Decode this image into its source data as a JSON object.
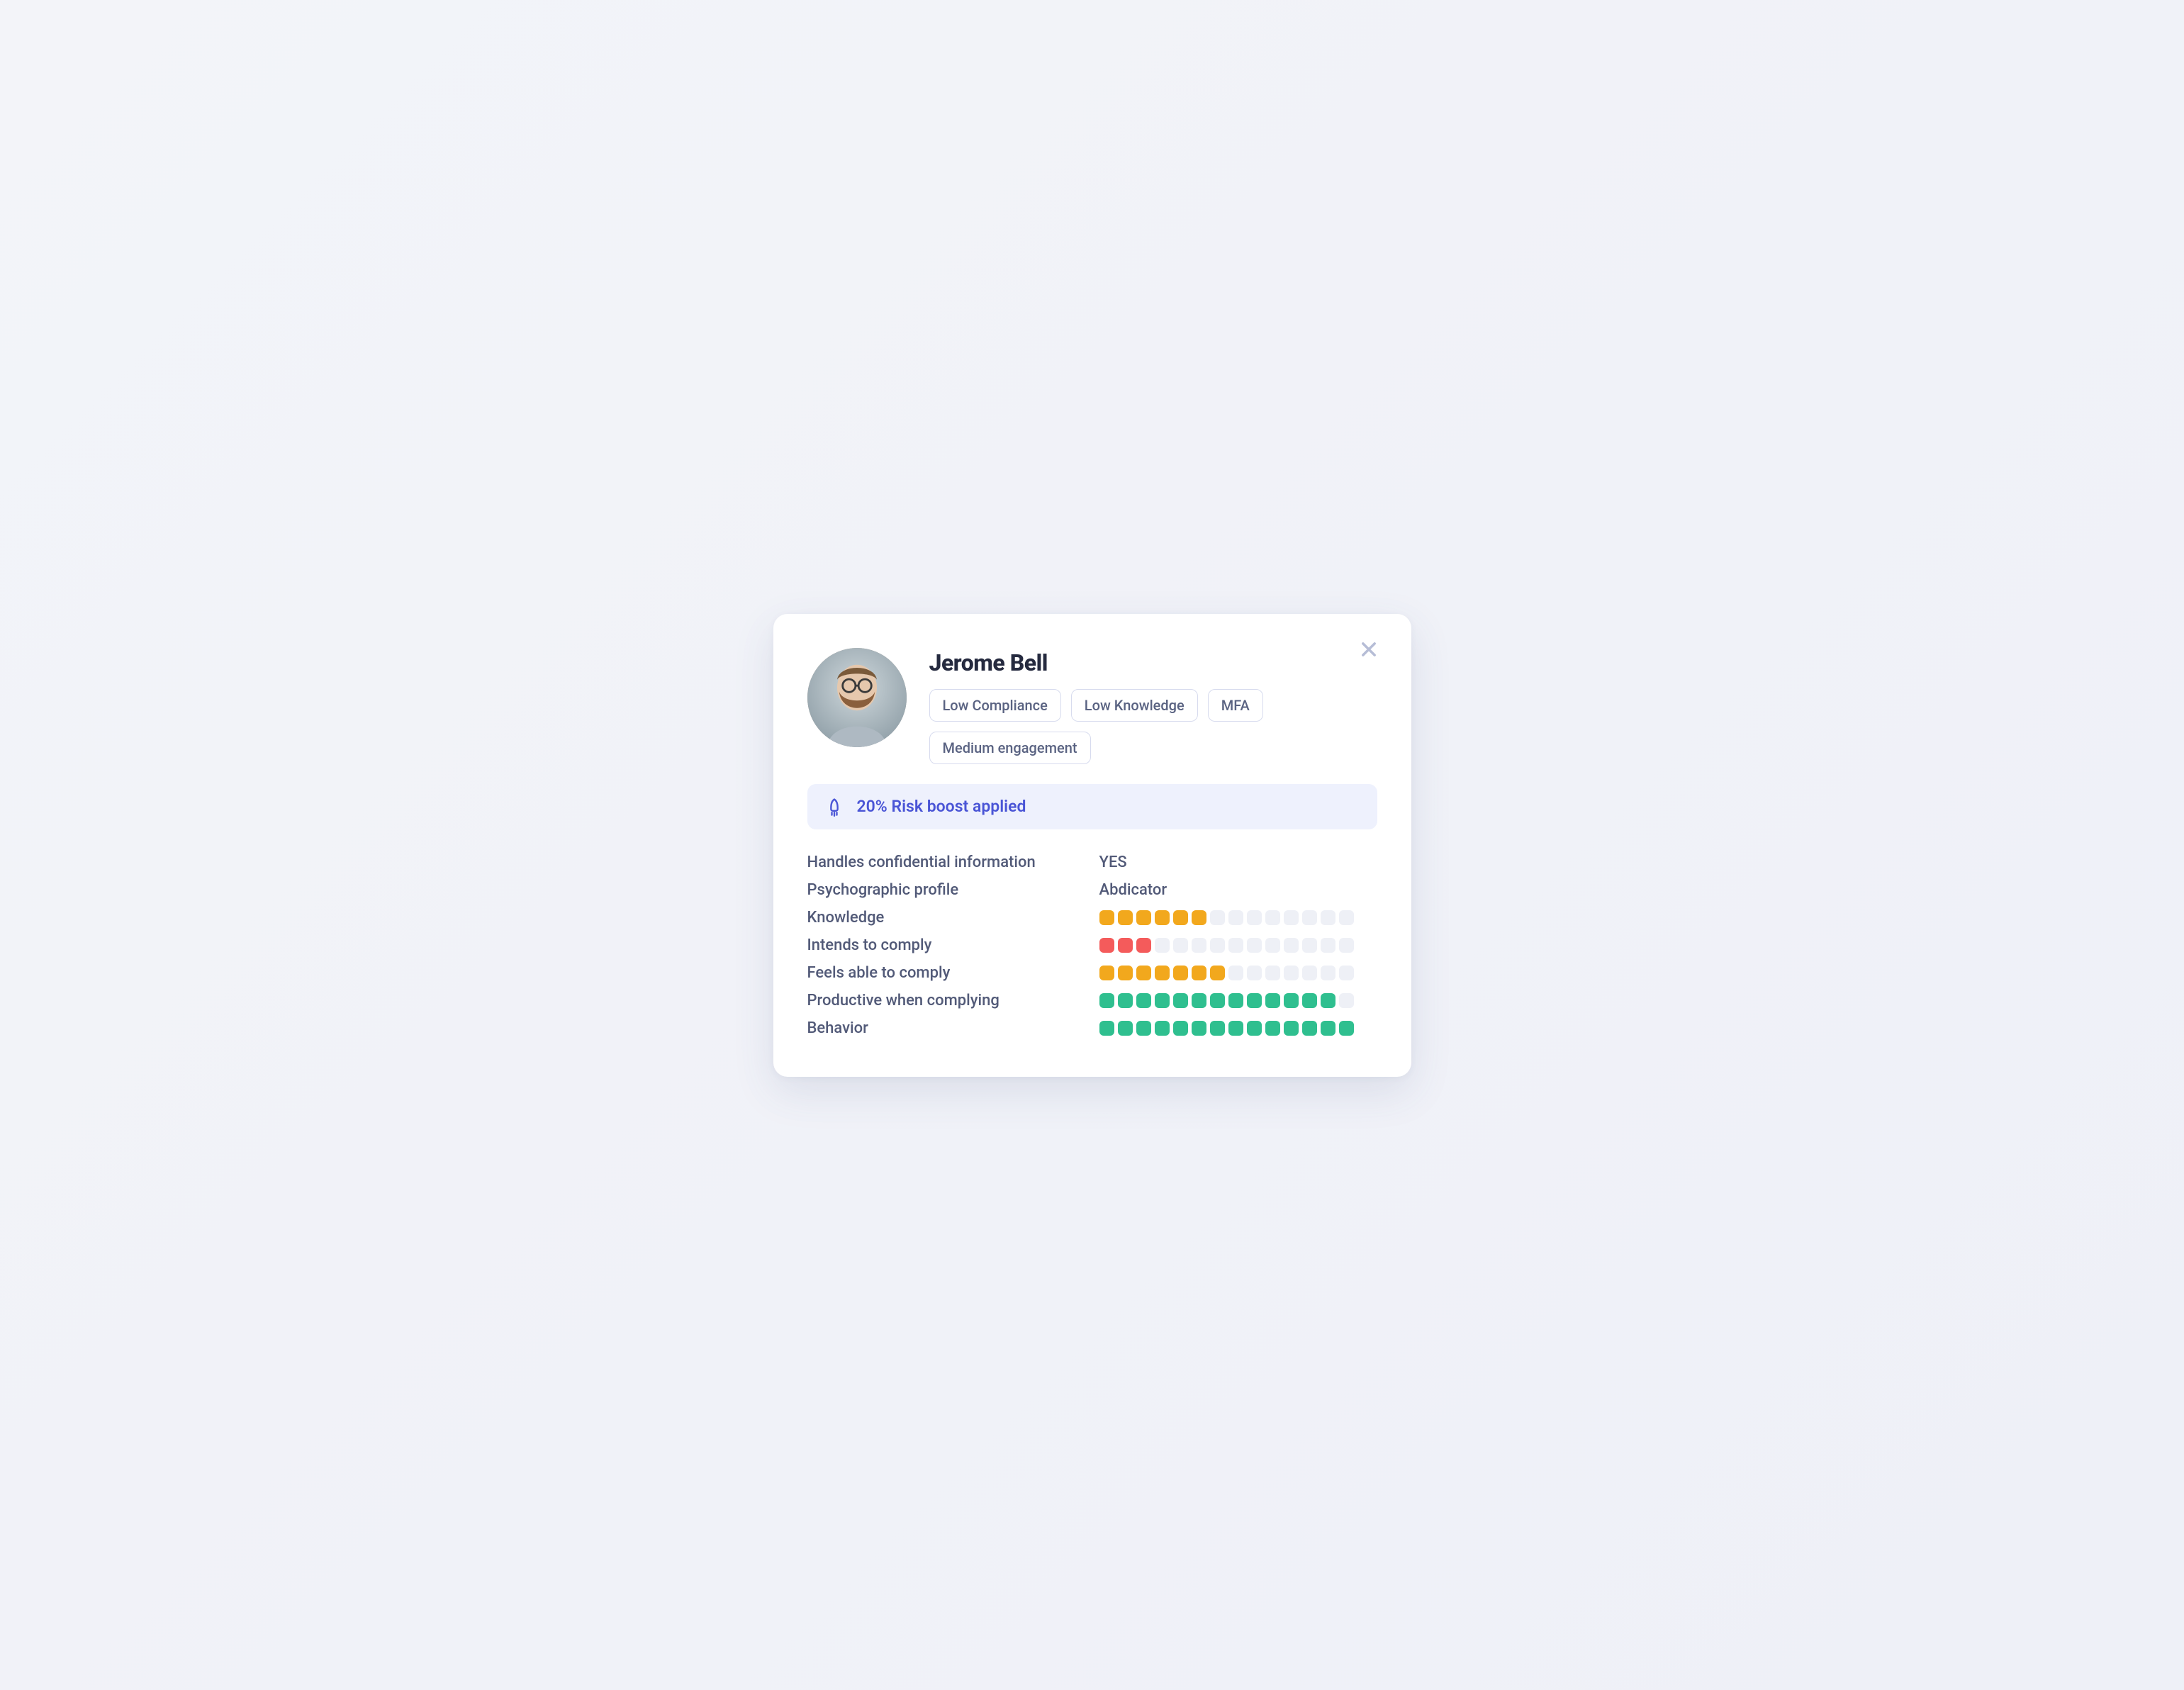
{
  "profile": {
    "name": "Jerome Bell",
    "tags": [
      "Low Compliance",
      "Low Knowledge",
      "MFA",
      "Medium engagement"
    ]
  },
  "banner": {
    "text": "20% Risk boost applied",
    "icon": "rocket-icon"
  },
  "rows": [
    {
      "label": "Handles confidential information",
      "type": "text",
      "value": "YES"
    },
    {
      "label": "Psychographic profile",
      "type": "text",
      "value": "Abdicator"
    },
    {
      "label": "Knowledge",
      "type": "bar",
      "filled": 6,
      "total": 14,
      "color": "#f2a81d"
    },
    {
      "label": "Intends to comply",
      "type": "bar",
      "filled": 3,
      "total": 14,
      "color": "#f45b5b"
    },
    {
      "label": "Feels able to comply",
      "type": "bar",
      "filled": 7,
      "total": 14,
      "color": "#f2a81d"
    },
    {
      "label": "Productive when complying",
      "type": "bar",
      "filled": 13,
      "total": 14,
      "color": "#2fbf8f"
    },
    {
      "label": "Behavior",
      "type": "bar",
      "filled": 14,
      "total": 14,
      "color": "#2fbf8f"
    }
  ],
  "colors": {
    "accent": "#4a55d6",
    "text": "#525a78",
    "heading": "#252a3f",
    "empty_seg": "#eef0f6"
  }
}
